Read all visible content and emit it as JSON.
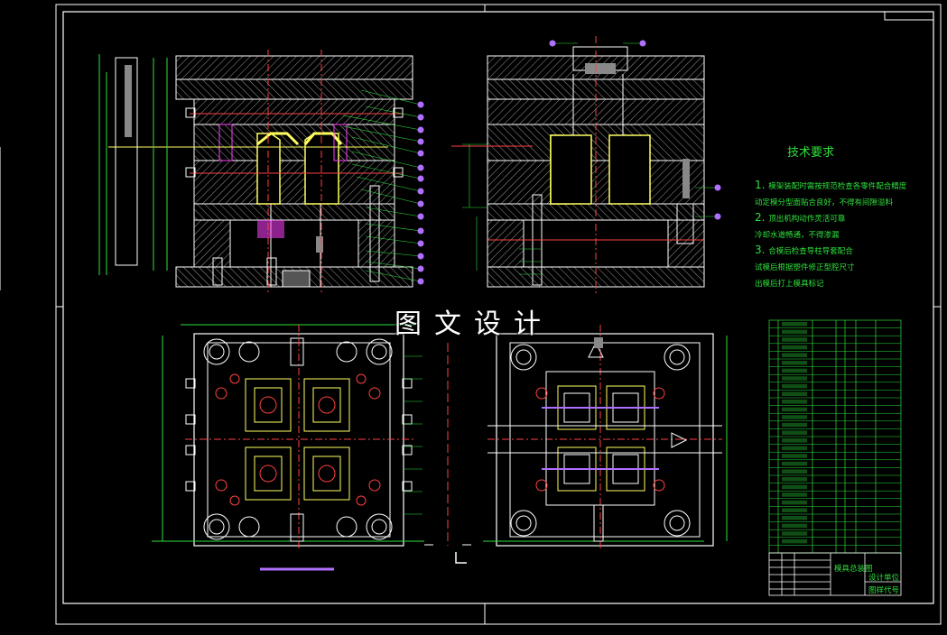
{
  "watermark": "图文设计",
  "tech_requirements": {
    "title": "技术要求",
    "lines": [
      {
        "num": "1",
        "text": "模架装配时需按规范检查各零件配合精度"
      },
      {
        "num": "",
        "text": "动定模分型面贴合良好，不得有间隙溢料"
      },
      {
        "num": "2",
        "text": "顶出机构动作灵活可靠"
      },
      {
        "num": "",
        "text": "冷却水道畅通，不得渗漏"
      },
      {
        "num": "3",
        "text": "合模后检查导柱导套配合"
      },
      {
        "num": "",
        "text": "试模后根据塑件修正型腔尺寸"
      },
      {
        "num": "",
        "text": "出模后打上模具标记"
      }
    ]
  },
  "title_block": {
    "product_label": "模具总装图",
    "company_label": "设计单位",
    "drawing_no_label": "图样代号"
  },
  "colors": {
    "frame": "#ffffff",
    "outline": "#ffffff",
    "hatch": "#b0b0b0",
    "dimension": "#2ee03c",
    "centerline": "#ff4040",
    "callout": "#b070ff",
    "cavity": "#ffff60",
    "plate_fill": "#707070",
    "tech_text": "#2ee03c",
    "magenta_label": "#ff40ff"
  }
}
